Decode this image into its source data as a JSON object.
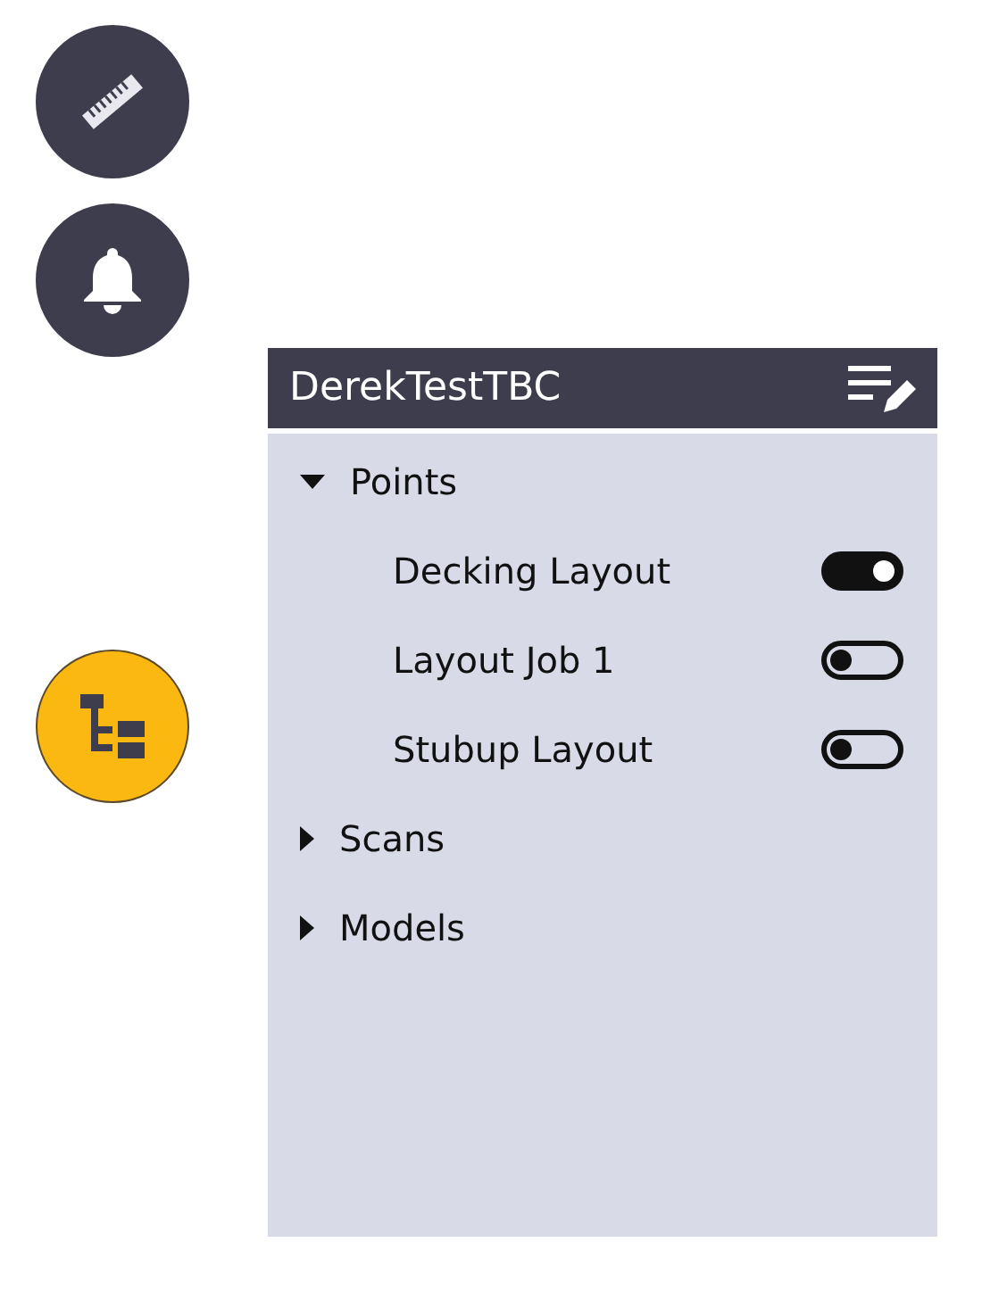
{
  "side_buttons": [
    {
      "kind": "ruler",
      "selected": false
    },
    {
      "kind": "bell",
      "selected": false
    },
    {
      "kind": "tree",
      "selected": true
    }
  ],
  "panel": {
    "title": "DerekTestTBC",
    "tree": [
      {
        "label": "Points",
        "expanded": true,
        "children": [
          {
            "label": "Decking Layout",
            "on": true
          },
          {
            "label": "Layout Job 1",
            "on": false
          },
          {
            "label": "Stubup Layout",
            "on": false
          }
        ]
      },
      {
        "label": "Scans",
        "expanded": false
      },
      {
        "label": "Models",
        "expanded": false
      }
    ]
  }
}
